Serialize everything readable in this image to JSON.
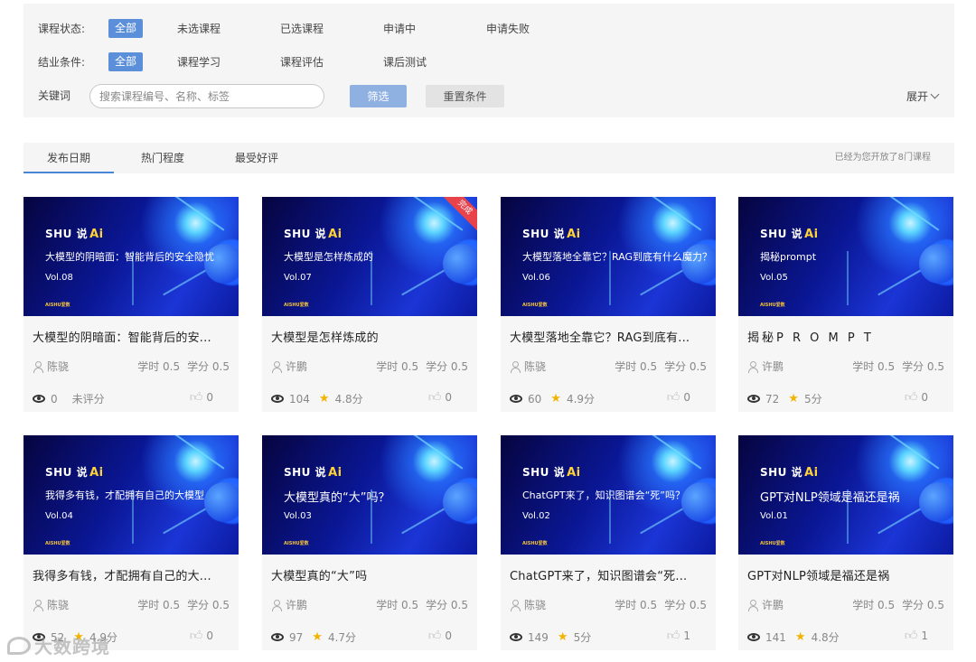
{
  "filters": {
    "status": {
      "label": "课程状态:",
      "options": [
        "全部",
        "未选课程",
        "已选课程",
        "申请中",
        "申请失败"
      ]
    },
    "completion": {
      "label": "结业条件:",
      "options": [
        "全部",
        "课程学习",
        "课程评估",
        "课后测试"
      ]
    },
    "keyword": {
      "label": "关键词",
      "placeholder": "搜索课程编号、名称、标签"
    },
    "filter_button": "筛选",
    "reset_button": "重置条件",
    "expand_label": "展开"
  },
  "sort": {
    "tabs": [
      "发布日期",
      "热门程度",
      "最受好评"
    ],
    "note": "已经为您开放了8门课程"
  },
  "cards": [
    {
      "thumb_title": "大模型的阴暗面：智能背后的安全隐忧",
      "vol": "Vol.08",
      "title": "大模型的阴暗面：智能背后的安...",
      "author": "陈骁",
      "hours": "学时 0.5",
      "credits": "学分 0.5",
      "views": "0",
      "rating": "未评分",
      "likes": "0"
    },
    {
      "thumb_title": "大模型是怎样炼成的",
      "vol": "Vol.07",
      "title": "大模型是怎样炼成的",
      "author": "许鹏",
      "hours": "学时 0.5",
      "credits": "学分 0.5",
      "views": "104",
      "rating": "4.8分",
      "likes": "0",
      "ribbon": "完成"
    },
    {
      "thumb_title": "大模型落地全靠它？RAG到底有什么魔力？",
      "vol": "Vol.06",
      "title": "大模型落地全靠它？RAG到底有...",
      "author": "陈骁",
      "hours": "学时 0.5",
      "credits": "学分 0.5",
      "views": "60",
      "rating": "4.9分",
      "likes": "0"
    },
    {
      "thumb_title": "揭秘prompt",
      "vol": "Vol.05",
      "title": "揭秘P R O M P T",
      "author": "许鹏",
      "hours": "学时 0.5",
      "credits": "学分 0.5",
      "views": "72",
      "rating": "5分",
      "likes": "0"
    },
    {
      "thumb_title": "我得多有钱，才配拥有自己的大模型",
      "vol": "Vol.04",
      "title": "我得多有钱，才配拥有自己的大...",
      "author": "陈骁",
      "hours": "学时 0.5",
      "credits": "学分 0.5",
      "views": "52",
      "rating": "4.9分",
      "likes": "0"
    },
    {
      "thumb_title": "大模型真的“大”吗？",
      "vol": "Vol.03",
      "title": "大模型真的“大”吗",
      "author": "许鹏",
      "hours": "学时 0.5",
      "credits": "学分 0.5",
      "views": "97",
      "rating": "4.7分",
      "likes": "0"
    },
    {
      "thumb_title": "ChatGPT来了，知识图谱会“死”吗？",
      "vol": "Vol.02",
      "title": "ChatGPT来了，知识图谱会“死...",
      "author": "陈骁",
      "hours": "学时 0.5",
      "credits": "学分 0.5",
      "views": "149",
      "rating": "5分",
      "likes": "1"
    },
    {
      "thumb_title": "GPT对NLP领域是福还是祸",
      "vol": "Vol.01",
      "title": "GPT对NLP领域是福还是祸",
      "author": "许鹏",
      "hours": "学时 0.5",
      "credits": "学分 0.5",
      "views": "141",
      "rating": "4.8分",
      "likes": "1"
    }
  ],
  "thumb_brand": {
    "shu": "SHU 说",
    "ai": "Ai",
    "logo": "AISHU爱数"
  },
  "watermark": "大数跨境",
  "colors": {
    "accent": "#5b8fd9",
    "filter_btn": "#8fb1e2",
    "star": "#f2b400",
    "ribbon": "#e8424b"
  }
}
